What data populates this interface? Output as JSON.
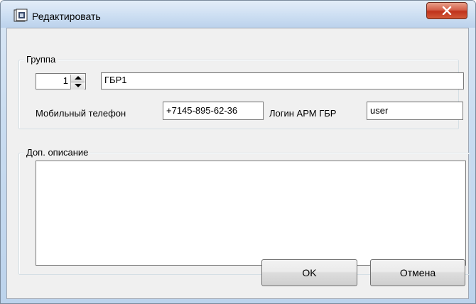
{
  "window": {
    "title": "Редактировать"
  },
  "group_section": {
    "legend": "Группа",
    "number_value": "1",
    "name_value": "ГБР1",
    "phone_label": "Мобильный телефон",
    "phone_value": "+7145-895-62-36",
    "login_label": "Логин АРМ ГБР",
    "login_value": "user"
  },
  "description_section": {
    "legend": "Доп. описание",
    "value": ""
  },
  "buttons": {
    "ok": "OK",
    "cancel": "Отмена"
  }
}
